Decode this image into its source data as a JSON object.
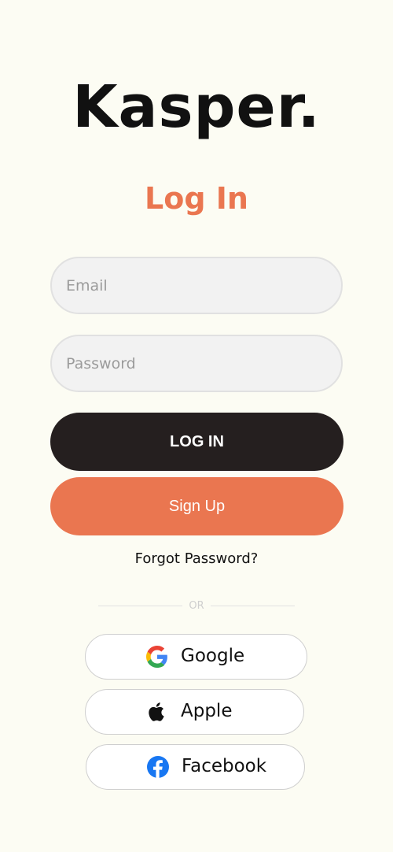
{
  "brand": {
    "name": "Kasper."
  },
  "page": {
    "title": "Log In"
  },
  "form": {
    "email_placeholder": "Email",
    "email_value": "",
    "password_placeholder": "Password",
    "password_value": ""
  },
  "buttons": {
    "login_label": "LOG IN",
    "signup_label": "Sign Up"
  },
  "links": {
    "forgot_password": "Forgot Password?"
  },
  "divider": {
    "label": "OR"
  },
  "social": [
    {
      "label": "Google",
      "icon": "google-icon"
    },
    {
      "label": "Apple",
      "icon": "apple-icon"
    },
    {
      "label": "Facebook",
      "icon": "facebook-icon"
    }
  ],
  "colors": {
    "background": "#fcfcf3",
    "accent": "#ea7650",
    "login_button": "#251f1f",
    "facebook_blue": "#1877f2"
  }
}
